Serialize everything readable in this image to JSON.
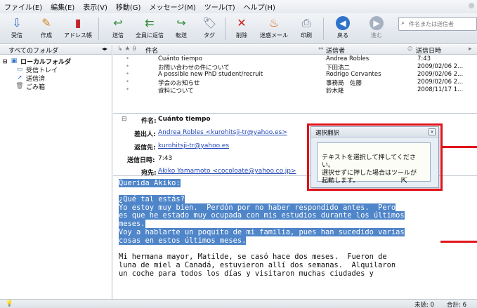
{
  "menu": [
    "ファイル(E)",
    "編集(E)",
    "表示(V)",
    "移動(G)",
    "メッセージ(M)",
    "ツール(T)",
    "ヘルプ(H)"
  ],
  "toolbar": {
    "receive": "受信",
    "compose": "作成",
    "address_book": "アドレス帳",
    "send": "送信",
    "reply_all": "全員に返信",
    "forward": "転送",
    "tag": "タグ",
    "delete": "削除",
    "junk": "迷惑メール",
    "print": "印刷",
    "back": "戻る",
    "forward_nav": "進む",
    "search_placeholder": "件名または送信者"
  },
  "folders": {
    "header": "すべてのフォルダ",
    "items": [
      {
        "label": "ローカルフォルダ",
        "icon": "computer-icon"
      },
      {
        "label": "受信トレイ",
        "icon": "inbox-icon"
      },
      {
        "label": "送信済",
        "icon": "sent-icon"
      },
      {
        "label": "ごみ箱",
        "icon": "trash-icon"
      }
    ]
  },
  "list": {
    "col_subject": "件名",
    "col_from": "送信者",
    "col_date": "送信日時",
    "rows": [
      {
        "subject": "Cuánto tiempo",
        "from": "Andrea Robles",
        "date": "7:43"
      },
      {
        "subject": "お問い合わせの件について",
        "from": "下田浩二",
        "date": "2009/02/06 2..."
      },
      {
        "subject": "A possible new PhD student/recruit",
        "from": "Rodrigo Cervantes",
        "date": "2009/02/06 2..."
      },
      {
        "subject": "学会のお知らせ",
        "from": "事務局　佐藤",
        "date": "2009/02/06 2..."
      },
      {
        "subject": "資料について",
        "from": "鈴木隆",
        "date": "2008/11/17 1..."
      }
    ]
  },
  "header": {
    "subject_label": "件名:",
    "subject": "Cuánto tiempo",
    "from_label": "差出人:",
    "from": "Andrea Robles <kurohitsji-tr@yahoo.es>",
    "reply_label": "返信先:",
    "reply": "kurohitsji-tr@yahoo.es",
    "date_label": "送信日時:",
    "date": "7:43",
    "to_label": "宛先:",
    "to": "Akiko Yamamoto <cocoloate@yahoo.co.jp>"
  },
  "popup": {
    "title": "選択翻訳",
    "text": "テキストを選択して押してください。\n選択せずに押した場合はツールが\n起動します。"
  },
  "body": {
    "line1": "Querida Akiko:",
    "para1": "¿Qué tal estás?\nYo estoy muy bien.  Perdón por no haber respondido antes.  Pero\nes que he estado muy ocupada con mis estudios durante los últimos\nmeses.\nVoy a hablarte un poquito de mi familia, pues han sucedido varias\ncosas en estos últimos meses.",
    "para2": "Mi hermana mayor, Matilde, se casó hace dos meses.  Fueron de\nluna de miel a Canadá, estuvieron allí dos semanas.  Alquilaron\nun coche para todos los días y visitaron muchas ciudades y"
  },
  "status": {
    "unread": "未読: 0",
    "total": "合計: 6"
  },
  "colors": {
    "accent": "#e0141b",
    "selection": "#4f85c9",
    "link": "#2146b8"
  }
}
